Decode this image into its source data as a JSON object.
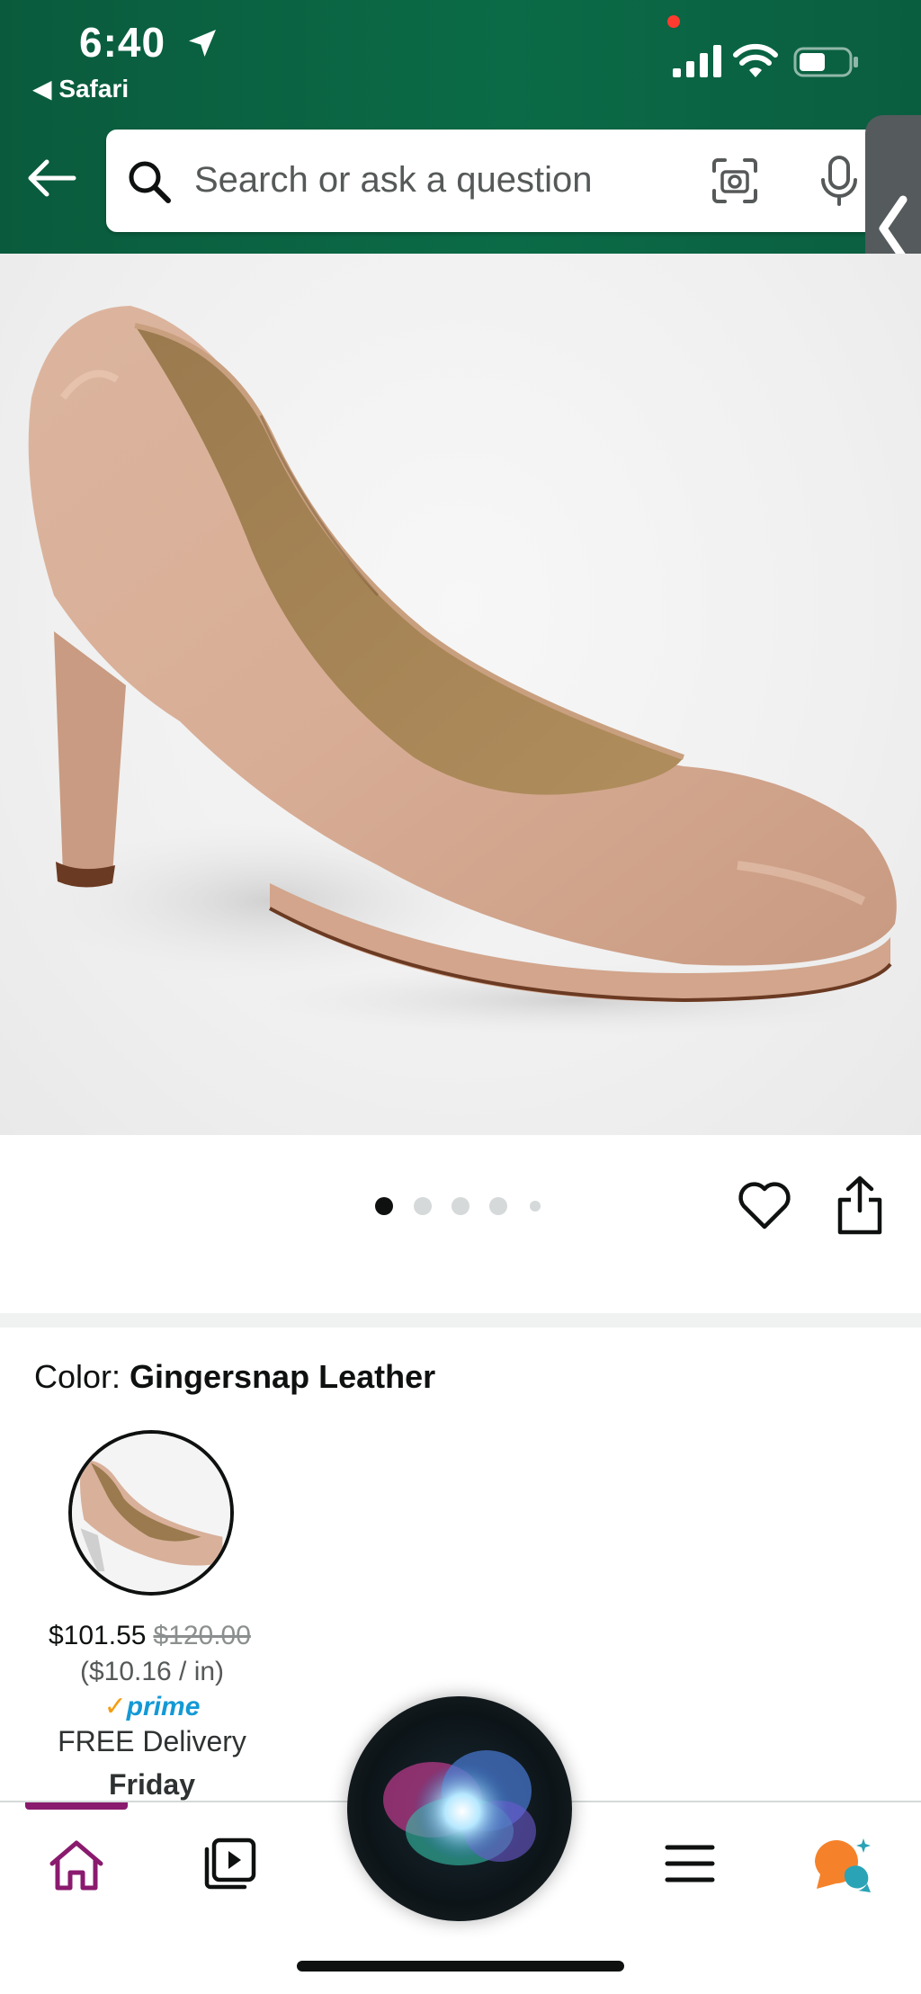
{
  "status_bar": {
    "time": "6:40",
    "back_app": "◀ Safari"
  },
  "search": {
    "placeholder": "Search or ask a question"
  },
  "product": {
    "image_dots": 5,
    "active_dot": 0
  },
  "color_section": {
    "label": "Color: ",
    "value": "Gingersnap Leather"
  },
  "variant": {
    "price": "$101.55",
    "list_price": "$120.00",
    "unit_price": "($10.16 / in)",
    "prime_check": "✓",
    "prime_label": "prime",
    "delivery": "FREE Delivery",
    "delivery_day": "Friday"
  },
  "bottom_nav": {
    "items": [
      "home-icon",
      "video-icon",
      "menu-icon",
      "rufus-icon"
    ],
    "active_color": "#8a1a6e"
  },
  "colors": {
    "header_green": "#0a5b3d",
    "prime_blue": "#1399d5",
    "rufus_orange": "#f5822a",
    "rufus_teal": "#2aa3b6"
  }
}
